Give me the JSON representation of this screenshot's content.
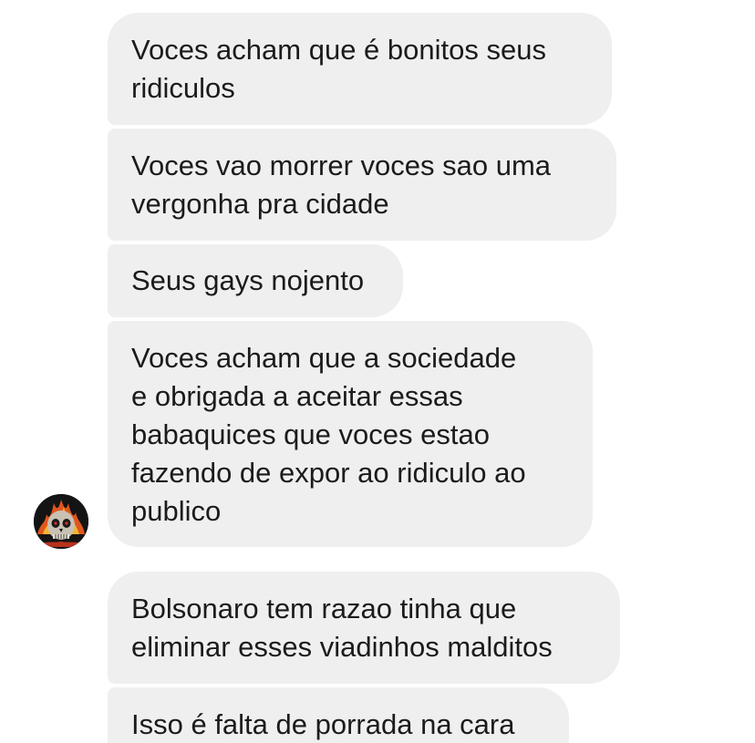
{
  "messages": [
    {
      "text": "Voces acham que é bonitos seus\nridiculos"
    },
    {
      "text": "Voces vao morrer voces sao uma\nvergonha pra cidade"
    },
    {
      "text": "Seus gays nojento"
    },
    {
      "text": "Voces acham que a sociedade\ne obrigada a aceitar essas\nbabaquices que voces estao\nfazendo de expor ao ridiculo ao\npublico"
    },
    {
      "text": "Bolsonaro tem razao tinha que\neliminar esses viadinhos malditos"
    },
    {
      "text": "Isso é falta de porrada na cara"
    }
  ],
  "sender": {
    "avatar_icon": "skull-flame-avatar-icon"
  },
  "colors": {
    "bubble_background": "#efefef",
    "text": "#1b1b1b",
    "page_background": "#ffffff"
  }
}
